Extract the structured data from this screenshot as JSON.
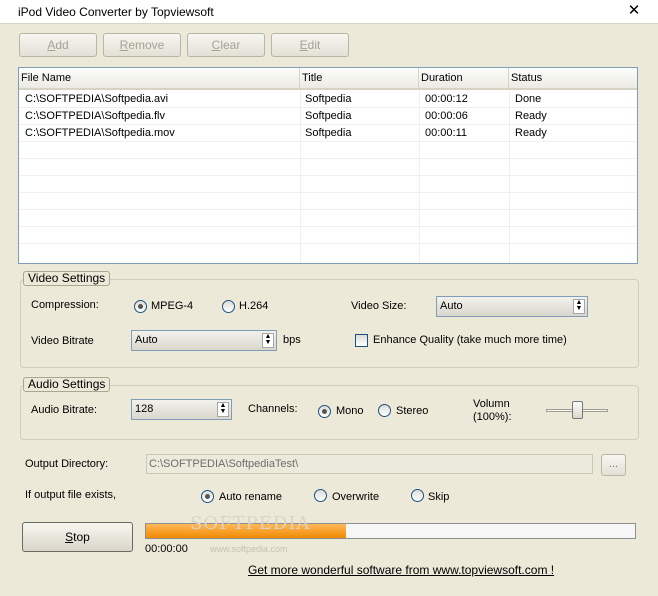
{
  "window": {
    "title": "iPod Video Converter by Topviewsoft",
    "close_glyph": "✕"
  },
  "toolbar": {
    "add": {
      "mnemonic": "A",
      "rest": "dd"
    },
    "remove": {
      "mnemonic": "R",
      "rest": "emove"
    },
    "clear": {
      "mnemonic": "C",
      "rest": "lear"
    },
    "edit": {
      "mnemonic": "E",
      "rest": "dit"
    }
  },
  "file_list": {
    "columns": [
      "File Name",
      "Title",
      "Duration",
      "Status"
    ],
    "rows": [
      {
        "file": "C:\\SOFTPEDIA\\Softpedia.avi",
        "title": "Softpedia",
        "duration": "00:00:12",
        "status": "Done"
      },
      {
        "file": "C:\\SOFTPEDIA\\Softpedia.flv",
        "title": "Softpedia",
        "duration": "00:00:06",
        "status": "Ready"
      },
      {
        "file": "C:\\SOFTPEDIA\\Softpedia.mov",
        "title": "Softpedia",
        "duration": "00:00:11",
        "status": "Ready"
      }
    ]
  },
  "video_settings": {
    "group_label": "Video Settings",
    "compression_label": "Compression:",
    "mpeg4_label": "MPEG-4",
    "h264_label": "H.264",
    "video_size_label": "Video Size:",
    "video_size_value": "Auto",
    "bitrate_label": "Video Bitrate",
    "bitrate_value": "Auto",
    "bitrate_unit": "bps",
    "enhance_label": "Enhance Quality (take much more time)"
  },
  "audio_settings": {
    "group_label": "Audio Settings",
    "bitrate_label": "Audio Bitrate:",
    "bitrate_value": "128",
    "channels_label": "Channels:",
    "mono_label": "Mono",
    "stereo_label": "Stereo",
    "volume_label_1": "Volumn",
    "volume_label_2": "(100%):",
    "volume_level": 0.5
  },
  "output": {
    "dir_label": "Output Directory:",
    "dir_value": "C:\\SOFTPEDIA\\SoftpediaTest\\",
    "browse_label": "...",
    "exists_label": "If output file exists,",
    "auto_rename_label": "Auto rename",
    "overwrite_label": "Overwrite",
    "skip_label": "Skip"
  },
  "progress": {
    "stop_mnemonic": "S",
    "stop_rest": "top",
    "fraction": 0.41,
    "elapsed": "00:00:00"
  },
  "footer": {
    "link": "Get more wonderful software from www.topviewsoft.com !"
  },
  "watermark": {
    "main": "SOFTPEDIA",
    "url": "www.softpedia.com"
  }
}
